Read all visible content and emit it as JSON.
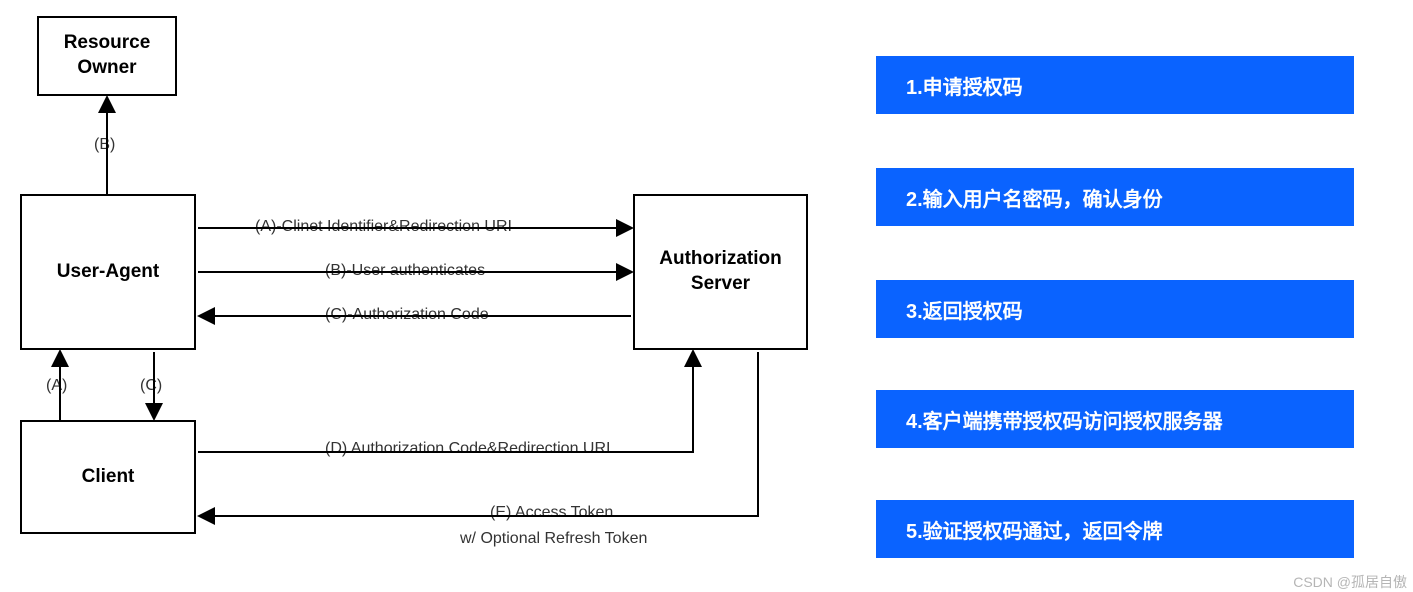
{
  "nodes": {
    "resource_owner": "Resource\nOwner",
    "user_agent": "User-Agent",
    "client": "Client",
    "auth_server": "Authorization\nServer"
  },
  "edge_labels": {
    "b_small": "(B)",
    "a_small": "(A)",
    "c_small": "(C)",
    "a": "(A)-Clinet Identifier&Redirection URI",
    "b": "(B)-User authenticates",
    "c": "(C)-Authorization Code",
    "d": "(D) Authorization Code&Redirection URI",
    "e": "(E) Access Token",
    "e_sub": "w/  Optional Refresh Token"
  },
  "steps": [
    "1.申请授权码",
    "2.输入用户名密码，确认身份",
    "3.返回授权码",
    "4.客户端携带授权码访问授权服务器",
    "5.验证授权码通过，返回令牌"
  ],
  "watermark": "CSDN @孤居自傲"
}
